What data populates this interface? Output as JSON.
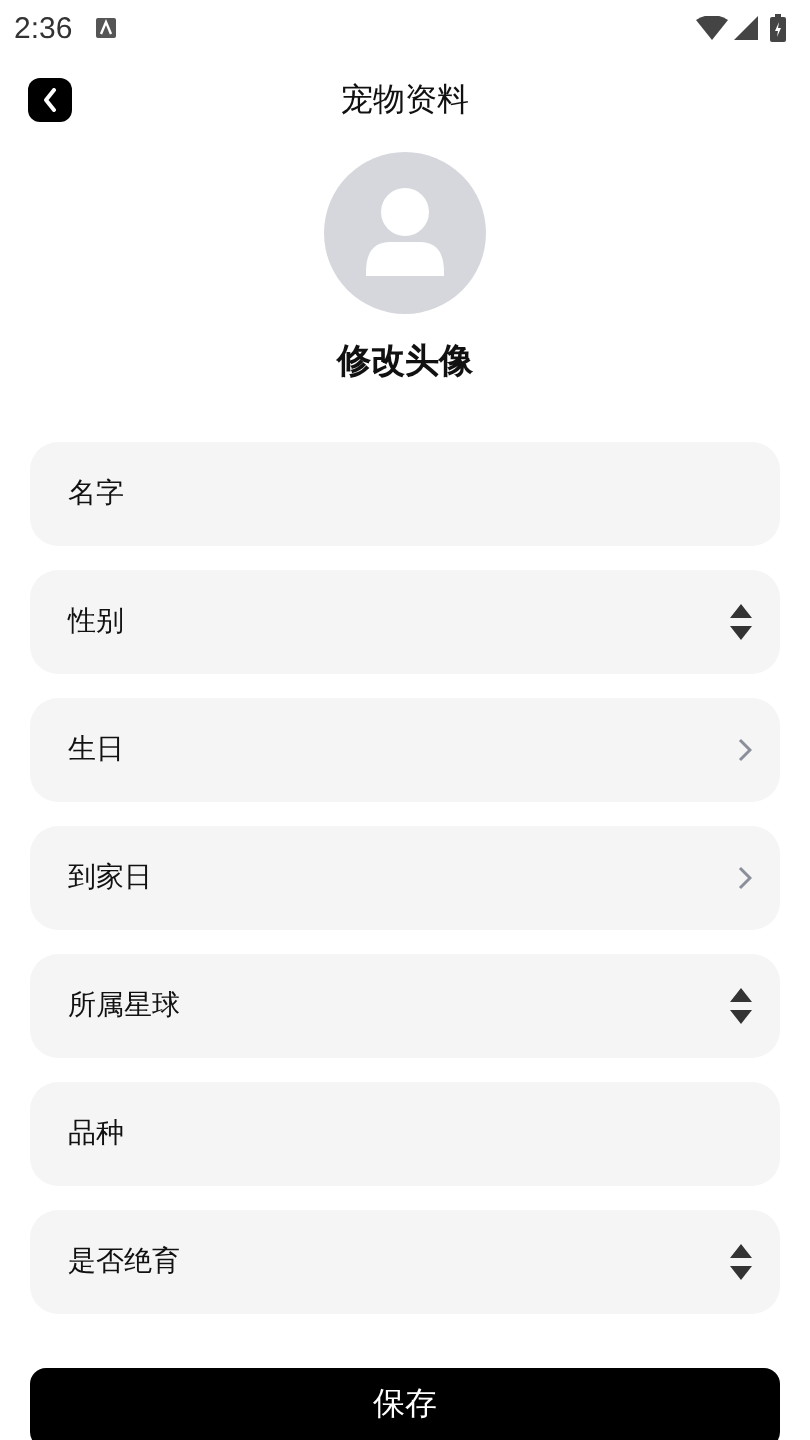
{
  "status_bar": {
    "time": "2:36"
  },
  "header": {
    "title": "宠物资料"
  },
  "avatar": {
    "label": "修改头像"
  },
  "fields": [
    {
      "label": "名字",
      "kind": "text"
    },
    {
      "label": "性别",
      "kind": "select"
    },
    {
      "label": "生日",
      "kind": "link"
    },
    {
      "label": "到家日",
      "kind": "link"
    },
    {
      "label": "所属星球",
      "kind": "select"
    },
    {
      "label": "品种",
      "kind": "text"
    },
    {
      "label": "是否绝育",
      "kind": "select"
    }
  ],
  "save_button": {
    "label": "保存"
  }
}
